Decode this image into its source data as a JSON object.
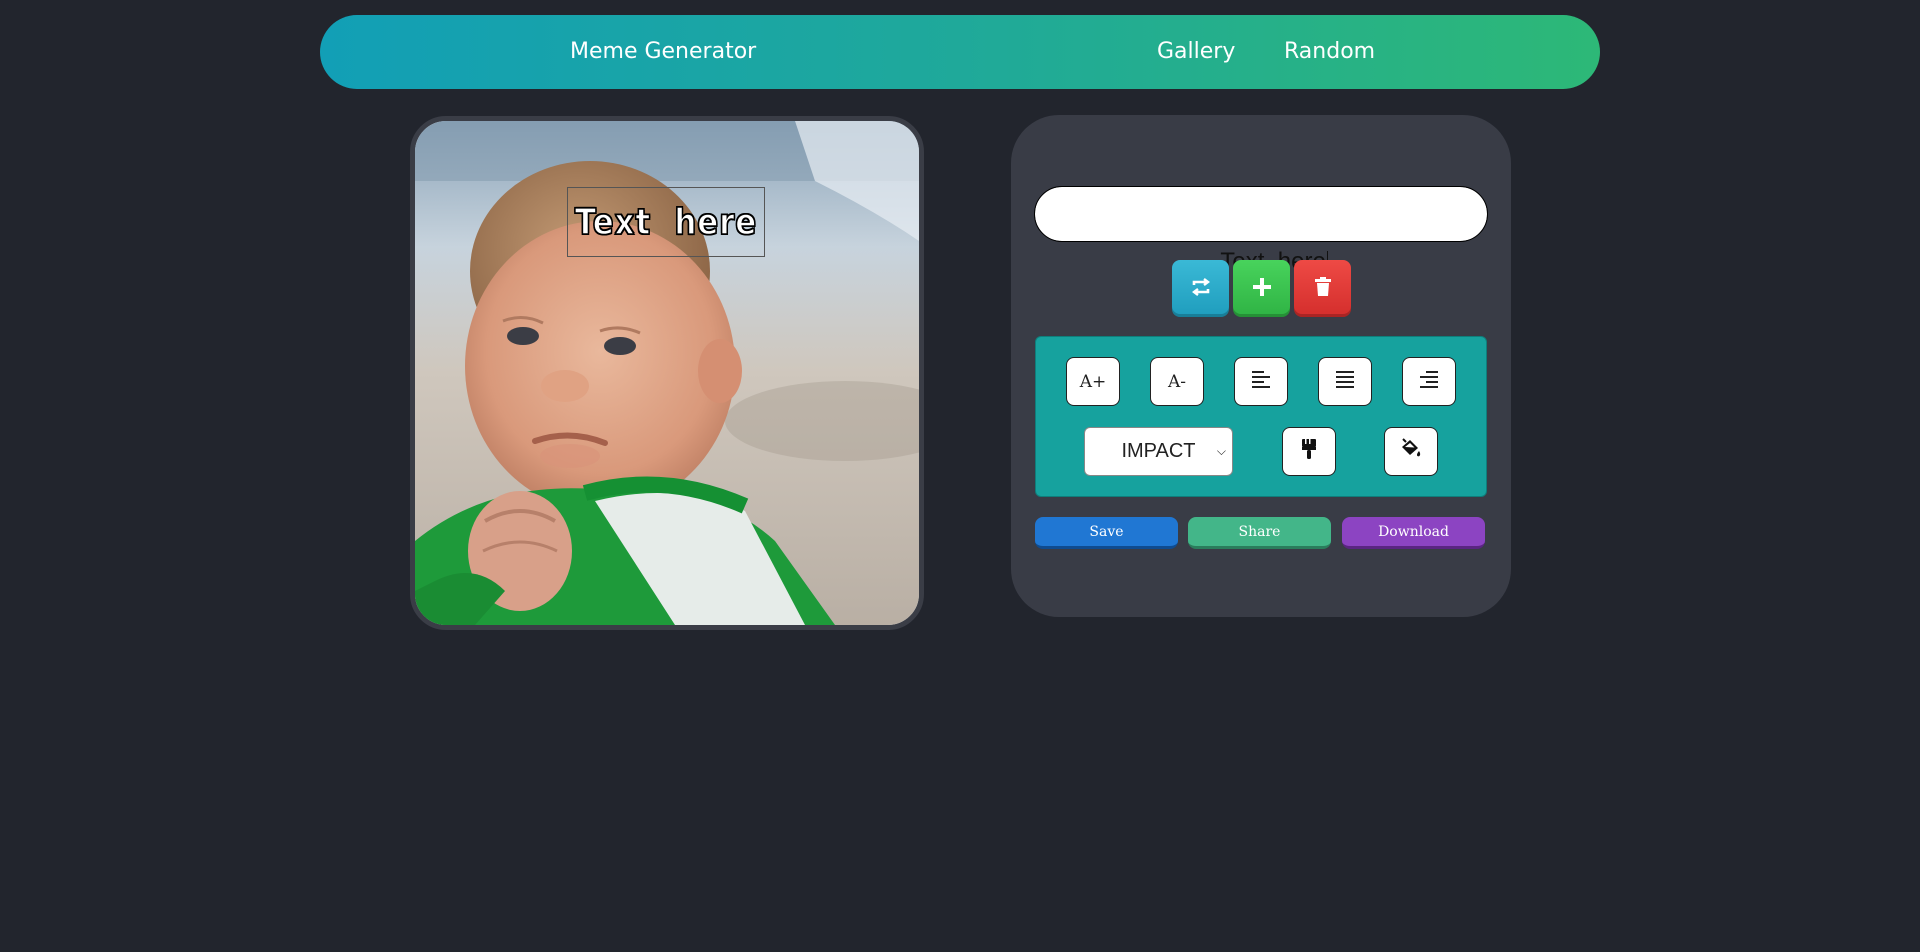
{
  "nav": {
    "brand": "Meme Generator",
    "links": [
      "Gallery",
      "Random"
    ]
  },
  "canvas": {
    "meme_text": "Text  here",
    "image_description_icon": "success-kid-image"
  },
  "editor": {
    "text_input_value": "Text  here",
    "actions": {
      "switch_icon": "switch-lines-icon",
      "add_icon": "plus-icon",
      "delete_icon": "trash-icon"
    },
    "tools": {
      "increase_font": "A+",
      "decrease_font": "A-",
      "align_left_icon": "align-left-icon",
      "align_center_icon": "align-center-icon",
      "align_right_icon": "align-right-icon",
      "font_family": "IMPACT",
      "stroke_color_icon": "brush-icon",
      "fill_color_icon": "paint-bucket-icon"
    },
    "buttons": {
      "save": "Save",
      "share": "Share",
      "download": "Download"
    }
  },
  "colors": {
    "background": "#22252d",
    "panel": "#393c46",
    "nav_gradient_start": "#129fb6",
    "nav_gradient_end": "#2db877",
    "tools_box": "#16a29e",
    "save": "#2077d3",
    "share": "#43b689",
    "download": "#8c44c2",
    "add": "#2fb344",
    "delete": "#d42e2c",
    "switch": "#1f9dbd"
  }
}
